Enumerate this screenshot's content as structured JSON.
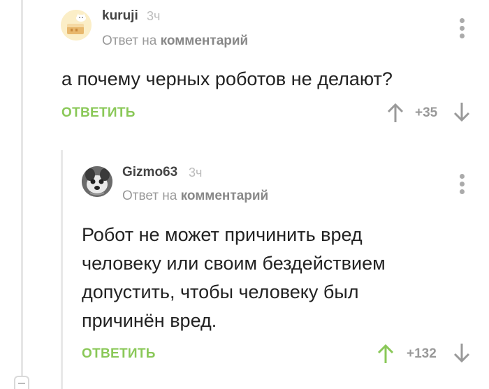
{
  "comment1": {
    "author": "kuruji",
    "time": "3ч",
    "reply_prefix": "Ответ на",
    "reply_target": "комментарий",
    "text": "а почему черных роботов не делают?",
    "reply_label": "ОТВЕТИТЬ",
    "rating": "+35"
  },
  "comment2": {
    "author": "Gizmo63",
    "time": "3ч",
    "reply_prefix": "Ответ на",
    "reply_target": "комментарий",
    "text_lines": [
      "Робот не может причинить вред",
      "человеку или своим бездействием",
      "допустить, чтобы человеку был",
      "причинён вред."
    ],
    "reply_label": "ОТВЕТИТЬ",
    "rating": "+132"
  },
  "colors": {
    "accent_green": "#8ac858",
    "upvote_green": "#8ac858",
    "icon_gray": "#9a9a9a"
  },
  "icons": {
    "avatar1": "cat-cake-avatar",
    "avatar2": "dog-avatar",
    "menu": "vertical-dots-icon",
    "upvote": "arrow-up-icon",
    "downvote": "arrow-down-icon"
  }
}
